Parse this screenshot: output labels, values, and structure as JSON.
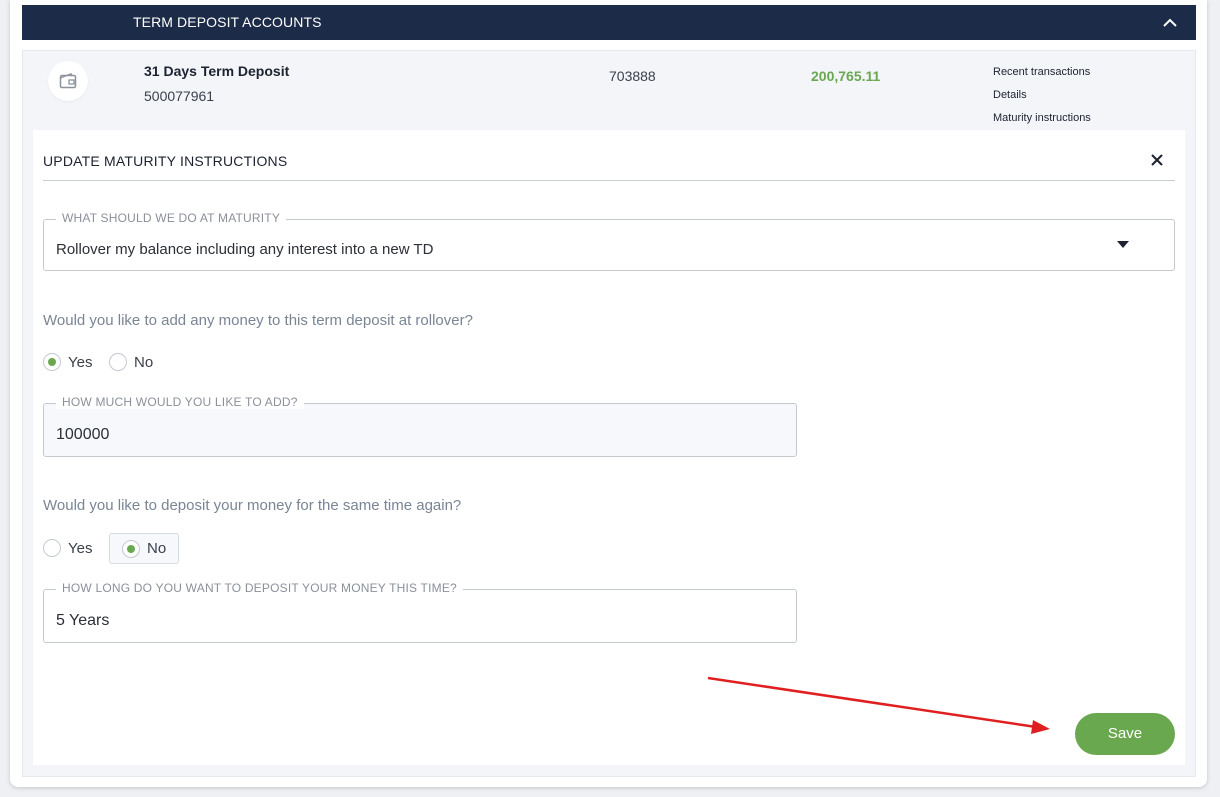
{
  "section": {
    "title": "TERM DEPOSIT ACCOUNTS"
  },
  "account": {
    "name": "31 Days Term Deposit",
    "number": "500077961",
    "bsb": "703888",
    "balance": "200,765.11",
    "links": [
      "Recent transactions",
      "Details",
      "Maturity instructions"
    ]
  },
  "modal": {
    "title": "UPDATE MATURITY INSTRUCTIONS",
    "maturity_field": {
      "label": "WHAT SHOULD WE DO AT MATURITY",
      "value": "Rollover my balance including any interest into a new TD"
    },
    "add_money_question": "Would you like to add any money to this term deposit at rollover?",
    "add_money_options": {
      "yes": "Yes",
      "no": "No",
      "selected": "Yes"
    },
    "amount_field": {
      "label": "HOW MUCH WOULD YOU LIKE TO ADD?",
      "value": "100000"
    },
    "same_time_question": "Would you like to deposit your money for the same time again?",
    "same_time_options": {
      "yes": "Yes",
      "no": "No",
      "selected": "No"
    },
    "duration_field": {
      "label": "HOW LONG DO YOU WANT TO DEPOSIT YOUR MONEY THIS TIME?",
      "value": "5 Years"
    },
    "save_label": "Save"
  },
  "colors": {
    "header_bg": "#1c2b47",
    "accent_green": "#6aa84f",
    "annotation_arrow": "#e02020"
  }
}
